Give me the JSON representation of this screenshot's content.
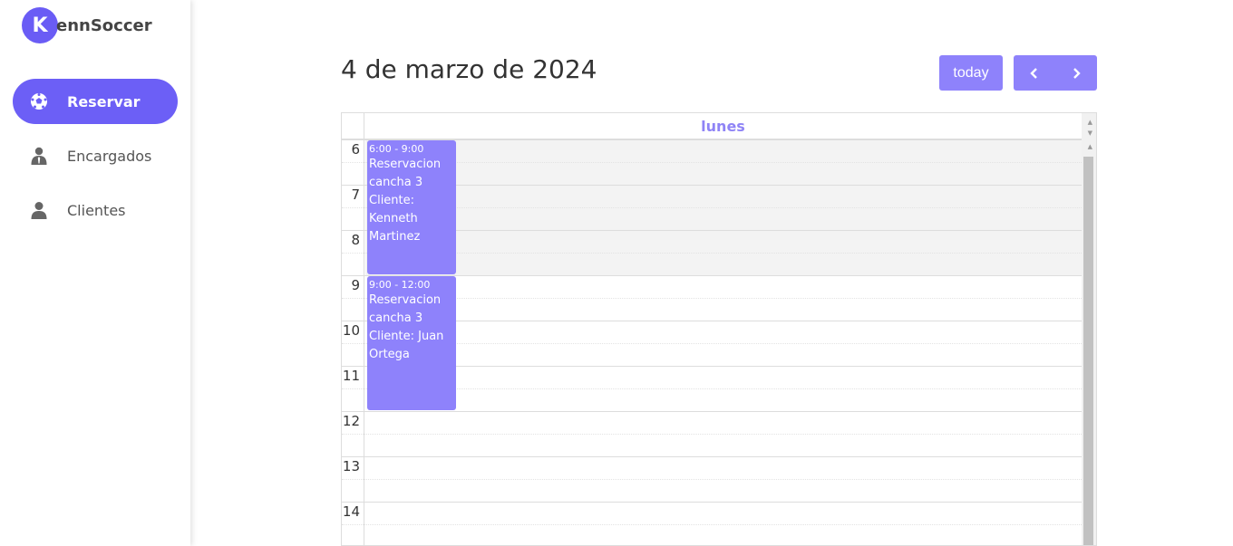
{
  "app": {
    "logo_letter": "K",
    "logo_text": "ennSoccer"
  },
  "sidebar": {
    "items": [
      {
        "label": "Reservar",
        "icon": "soccer-ball-icon",
        "active": true
      },
      {
        "label": "Encargados",
        "icon": "manager-icon",
        "active": false
      },
      {
        "label": "Clientes",
        "icon": "user-icon",
        "active": false
      }
    ]
  },
  "header": {
    "date_title": "4 de marzo de 2024",
    "today_label": "today",
    "prev_label": "‹",
    "next_label": "›"
  },
  "calendar": {
    "day_label": "lunes",
    "hours": [
      "6",
      "7",
      "8",
      "9",
      "10",
      "11",
      "12",
      "13",
      "14"
    ],
    "events": [
      {
        "time": "6:00 - 9:00",
        "title": "Reservacion cancha 3 Cliente: Kenneth Martinez"
      },
      {
        "time": "9:00 - 12:00",
        "title": "Reservacion cancha 3 Cliente: Juan Ortega"
      }
    ]
  },
  "colors": {
    "accent": "#6c5ff6",
    "event": "#8e82fb",
    "day_label": "#8f84f6"
  }
}
